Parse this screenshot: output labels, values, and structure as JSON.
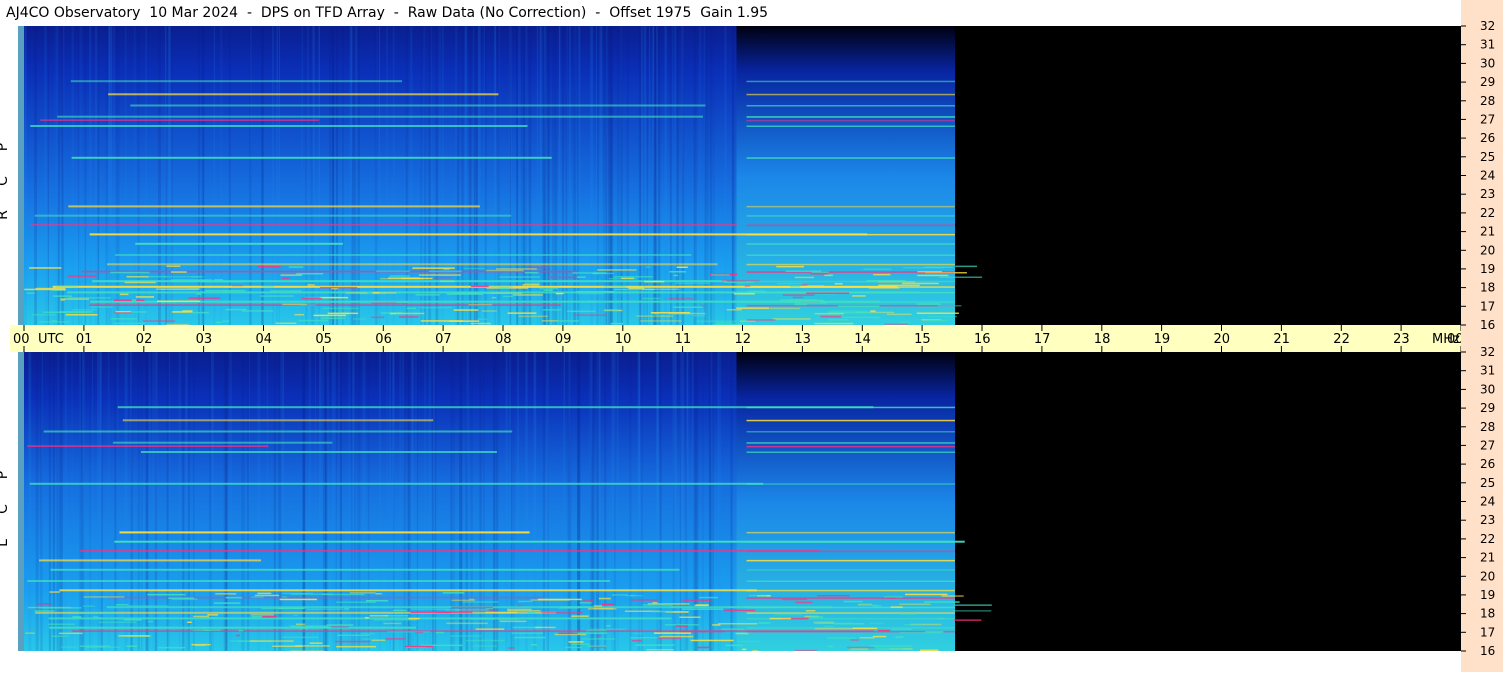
{
  "title": "AJ4CO Observatory  10 Mar 2024  -  DPS on TFD Array  -  Raw Data (No Correction)  -  Offset 1975  Gain 1.95",
  "panels": [
    {
      "id": "rcp",
      "label": [
        "R",
        "C",
        "P"
      ]
    },
    {
      "id": "lcp",
      "label": [
        "L",
        "C",
        "P"
      ]
    }
  ],
  "time_axis": {
    "labels": [
      "00",
      "01",
      "02",
      "03",
      "04",
      "05",
      "06",
      "07",
      "08",
      "09",
      "10",
      "11",
      "12",
      "13",
      "14",
      "15",
      "16",
      "17",
      "18",
      "19",
      "20",
      "21",
      "22",
      "23",
      "00"
    ],
    "unit_left": "UTC",
    "unit_right": "MHz"
  },
  "colors": {
    "background": "#000000",
    "low": "#0a2fb8",
    "mid": "#1a9ff0",
    "high": "#40e0c0",
    "peak": "#ffe040",
    "hot": "#ff3080"
  },
  "chart_data": {
    "type": "heatmap",
    "title": "AJ4CO Observatory  10 Mar 2024  -  DPS on TFD Array  -  Raw Data (No Correction)  -  Offset 1975  Gain 1.95",
    "xlabel": "UTC",
    "ylabel": "MHz",
    "x_ticks": [
      "00",
      "01",
      "02",
      "03",
      "04",
      "05",
      "06",
      "07",
      "08",
      "09",
      "10",
      "11",
      "12",
      "13",
      "14",
      "15",
      "16",
      "17",
      "18",
      "19",
      "20",
      "21",
      "22",
      "23",
      "00"
    ],
    "y_ticks": [
      16,
      17,
      18,
      19,
      20,
      21,
      22,
      23,
      24,
      25,
      26,
      27,
      28,
      29,
      30,
      31,
      32
    ],
    "x_range_hours": [
      0,
      24
    ],
    "y_range_mhz": [
      16,
      32
    ],
    "data_coverage_hours": [
      0,
      15.55
    ],
    "gain_switch_hour": 11.9,
    "series": [
      {
        "name": "RCP"
      },
      {
        "name": "LCP"
      }
    ]
  }
}
